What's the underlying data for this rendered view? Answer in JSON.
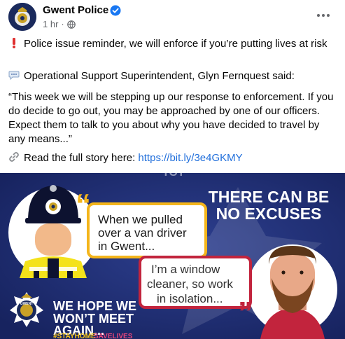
{
  "post": {
    "page_name": "Gwent Police",
    "time": "1 hr",
    "separator": "·",
    "line1": "Police issue reminder, we will enforce if you’re putting lives at risk",
    "line2": "Operational Support Superintendent, Glyn Fernquest said:",
    "quote": "“This week we will be stepping up our response to enforcement. If you do decide to go out, you may be approached by one of our officers. Expect them to talk to you about why you have decided to travel by any means...”",
    "read_label": "Read the full story here: ",
    "link": "https://bit.ly/3e4GKMY"
  },
  "banner": {
    "top_word": "TOT",
    "headline_line1": "THERE CAN BE",
    "headline_line2": "NO EXCUSES",
    "officer_bubble_line1": "When we pulled",
    "officer_bubble_line2": "over a van driver",
    "officer_bubble_line3": "in Gwent...",
    "driver_bubble_line1": "I’m a window",
    "driver_bubble_line2": "cleaner, so work",
    "driver_bubble_line3": "in isolation...",
    "footer_line1": "WE HOPE WE",
    "footer_line2": "WON’T MEET",
    "footer_line3": "AGAIN...",
    "hashtag_part1": "#STAYHOME",
    "hashtag_part2": "SAVELIVES",
    "crest_text": "GWENT"
  },
  "icons": {
    "verified": "verified-badge-icon",
    "globe": "globe-icon",
    "more": "more-options-icon",
    "exclamation": "exclamation-icon",
    "speech": "speech-bubble-icon",
    "link": "link-icon"
  },
  "colors": {
    "link": "#216fdb",
    "banner_blue": "#1c2d72",
    "bubble_yellow": "#f4b51b",
    "bubble_red": "#c2243d",
    "hashtag_yellow": "#f5c518",
    "hashtag_pink": "#e8457a"
  }
}
